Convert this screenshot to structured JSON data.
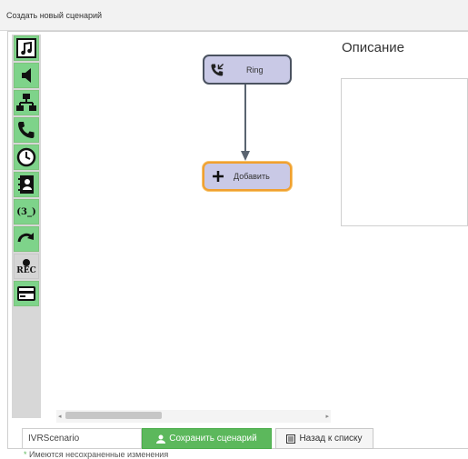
{
  "window": {
    "title": "Создать новый сценарий"
  },
  "toolbar": {
    "tools": [
      {
        "name": "music-note-icon"
      },
      {
        "name": "speaker-icon"
      },
      {
        "name": "hierarchy-icon"
      },
      {
        "name": "phone-icon"
      },
      {
        "name": "clock-icon"
      },
      {
        "name": "contact-book-icon"
      },
      {
        "name": "dial-code-icon",
        "text": "(3_)"
      },
      {
        "name": "redirect-arrow-icon"
      },
      {
        "name": "record-icon",
        "text": "REC"
      },
      {
        "name": "card-icon"
      }
    ]
  },
  "flow": {
    "nodes": [
      {
        "label": "Ring",
        "icon": "phone-incoming-icon"
      },
      {
        "label": "Добавить",
        "icon": "plus-icon"
      }
    ]
  },
  "description": {
    "title": "Описание",
    "value": ""
  },
  "bottom": {
    "name_input_value": "IVRScenario",
    "save_label": "Сохранить сценарий",
    "back_label": "Назад к списку",
    "warning_text": "Имеются несохраненные изменения"
  },
  "colors": {
    "accent": "#5cb85c",
    "tool_bg": "#7ed38a",
    "node_bg": "#c9c9e6",
    "node_active_border": "#f0a030"
  }
}
